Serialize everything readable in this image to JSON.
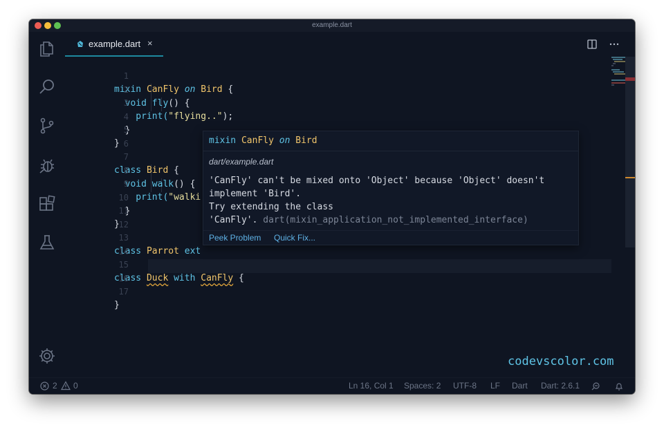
{
  "window": {
    "title": "example.dart",
    "traffic_lights": {
      "close_color": "#ee5c54",
      "minimize_color": "#f6bd3b",
      "zoom_color": "#5fc052"
    }
  },
  "activity_bar": {
    "icons": [
      "files-icon",
      "search-icon",
      "source-control-icon",
      "debug-icon",
      "extensions-icon",
      "testing-icon"
    ],
    "bottom_icon": "gear-icon"
  },
  "tabs": [
    {
      "label": "example.dart",
      "close": "×",
      "active": true
    }
  ],
  "editor": {
    "line_numbers": [
      "1",
      "2",
      "3",
      "4",
      "5",
      "6",
      "7",
      "8",
      "9",
      "10",
      "11",
      "12",
      "13",
      "14",
      "15",
      "16",
      "17"
    ],
    "code": {
      "l1": {
        "a": "mixin ",
        "b": "CanFly",
        "c": " on ",
        "d": "Bird",
        "e": " {"
      },
      "l2": {
        "a": "  void ",
        "b": "fly",
        "c": "() {"
      },
      "l3": {
        "a": "    print(",
        "b": "\"flying..\"",
        "c": ");"
      },
      "l4": {
        "a": "  }"
      },
      "l5": {
        "a": "}"
      },
      "l7": {
        "a": "class ",
        "b": "Bird",
        "c": " {"
      },
      "l8": {
        "a": "  void ",
        "b": "walk",
        "c": "() {"
      },
      "l9": {
        "a": "    print(",
        "b": "\"walki"
      },
      "l10": {
        "a": "  }"
      },
      "l11": {
        "a": "}"
      },
      "l13": {
        "a": "class ",
        "b": "Parrot",
        "c": " ext"
      },
      "l15": {
        "a": "class ",
        "b": "Duck",
        "c": " with ",
        "d": "CanFly",
        "e": " {"
      },
      "l17": {
        "a": "}"
      }
    }
  },
  "hover": {
    "signature": {
      "a": "mixin ",
      "b": "CanFly",
      "c": " on ",
      "d": "Bird"
    },
    "file": "dart/example.dart",
    "message_lines": [
      "'CanFly' can't be mixed onto 'Object' because 'Object' doesn't",
      "implement 'Bird'.",
      "Try extending the class"
    ],
    "message_last": "'CanFly'.",
    "error_code": "dart(mixin_application_not_implemented_interface)",
    "actions": {
      "peek": "Peek Problem",
      "quick_fix": "Quick Fix..."
    }
  },
  "status_bar": {
    "errors": "2",
    "warnings": "0",
    "position": "Ln 16, Col 1",
    "spaces": "Spaces: 2",
    "encoding": "UTF-8",
    "eol": "LF",
    "language": "Dart",
    "sdk": "Dart: 2.6.1"
  },
  "watermark": "codevscolor.com",
  "colors": {
    "accent": "#5fc4e6",
    "type": "#f1c56b",
    "string": "#e8df9e",
    "background": "#0f1522",
    "link": "#5fb2e6"
  }
}
